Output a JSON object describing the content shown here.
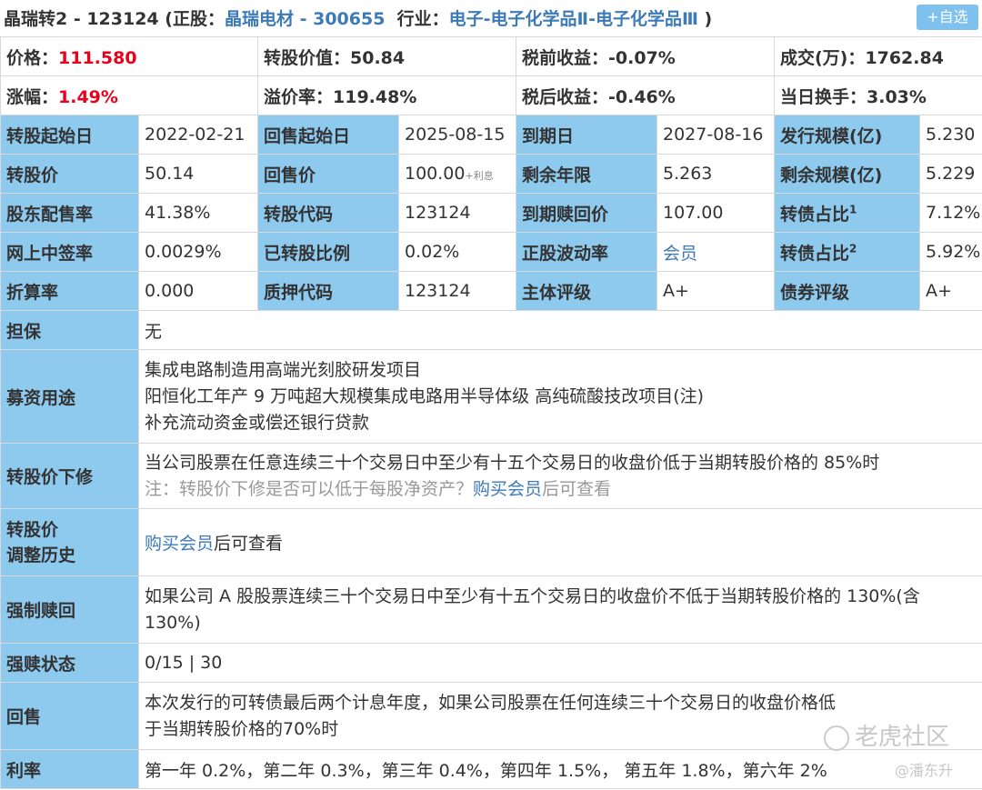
{
  "header": {
    "name": "晶瑞转2 - 123124",
    "stock_prefix": "(正股：",
    "stock_name": "晶瑞电材 - 300655",
    "industry_prefix": "行业：",
    "industry": "电子-电子化学品Ⅱ-电子化学品Ⅲ",
    "suffix": ")",
    "add_button": "+自选"
  },
  "summary": {
    "price_label": "价格：",
    "price": "111.580",
    "conv_value_label": "转股价值：",
    "conv_value": "50.84",
    "pretax_label": "税前收益：",
    "pretax": "-0.07%",
    "volume_label": "成交(万)：",
    "volume": "1762.84",
    "change_label": "涨幅：",
    "change": "1.49%",
    "premium_label": "溢价率：",
    "premium": "119.48%",
    "aftertax_label": "税后收益：",
    "aftertax": "-0.46%",
    "turnover_label": "当日换手：",
    "turnover": "3.03%"
  },
  "rows": [
    [
      "转股起始日",
      "2022-02-21",
      "回售起始日",
      "2025-08-15",
      "到期日",
      "2027-08-16",
      "发行规模(亿)",
      "5.230"
    ],
    [
      "转股价",
      "50.14",
      "回售价",
      "100.00",
      "剩余年限",
      "5.263",
      "剩余规模(亿)",
      "5.229"
    ],
    [
      "股东配售率",
      "41.38%",
      "转股代码",
      "123124",
      "到期赎回价",
      "107.00",
      "转债占比",
      "7.12%"
    ],
    [
      "网上中签率",
      "0.0029%",
      "已转股比例",
      "0.02%",
      "正股波动率",
      "会员",
      "转债占比",
      "5.92%"
    ],
    [
      "折算率",
      "0.000",
      "质押代码",
      "123124",
      "主体评级",
      "A+",
      "债券评级",
      "A+"
    ]
  ],
  "put_price_note": "+利息",
  "sup1": "1",
  "sup2": "2",
  "details": {
    "guarantee_label": "担保",
    "guarantee": "无",
    "funds_label": "募资用途",
    "funds": [
      "集成电路制造用高端光刻胶研发项目",
      "阳恒化工年产 9 万吨超大规模集成电路用半导体级 高纯硫酸技改项目(注)",
      "补充流动资金或偿还银行贷款"
    ],
    "down_label": "转股价下修",
    "down_text": "当公司股票在任意连续三十个交易日中至少有十五个交易日的收盘价低于当期转股价格的 85%时",
    "down_note": "注：转股价下修是否可以低于每股净资产？",
    "buy_member": "购买会员",
    "view_after": "后可查看",
    "adjust_label_1": "转股价",
    "adjust_label_2": "调整历史",
    "redeem_label": "强制赎回",
    "redeem_text": "如果公司 A 股股票连续三十个交易日中至少有十五个交易日的收盘价不低于当期转股价格的 130%(含 130%)",
    "redeem_status_label": "强赎状态",
    "redeem_status": "0/15 | 30",
    "putback_label": "回售",
    "putback_text": "本次发行的可转债最后两个计息年度，如果公司股票在任何连续三十个交易日的收盘价格低于当期转股价格的70%时",
    "rate_label": "利率",
    "rate": "第一年 0.2%，第二年 0.3%，第三年 0.4%，第四年 1.5%， 第五年 1.8%，第六年 2%"
  },
  "watermark": {
    "brand": "老虎社区",
    "user": "@潘东升"
  }
}
